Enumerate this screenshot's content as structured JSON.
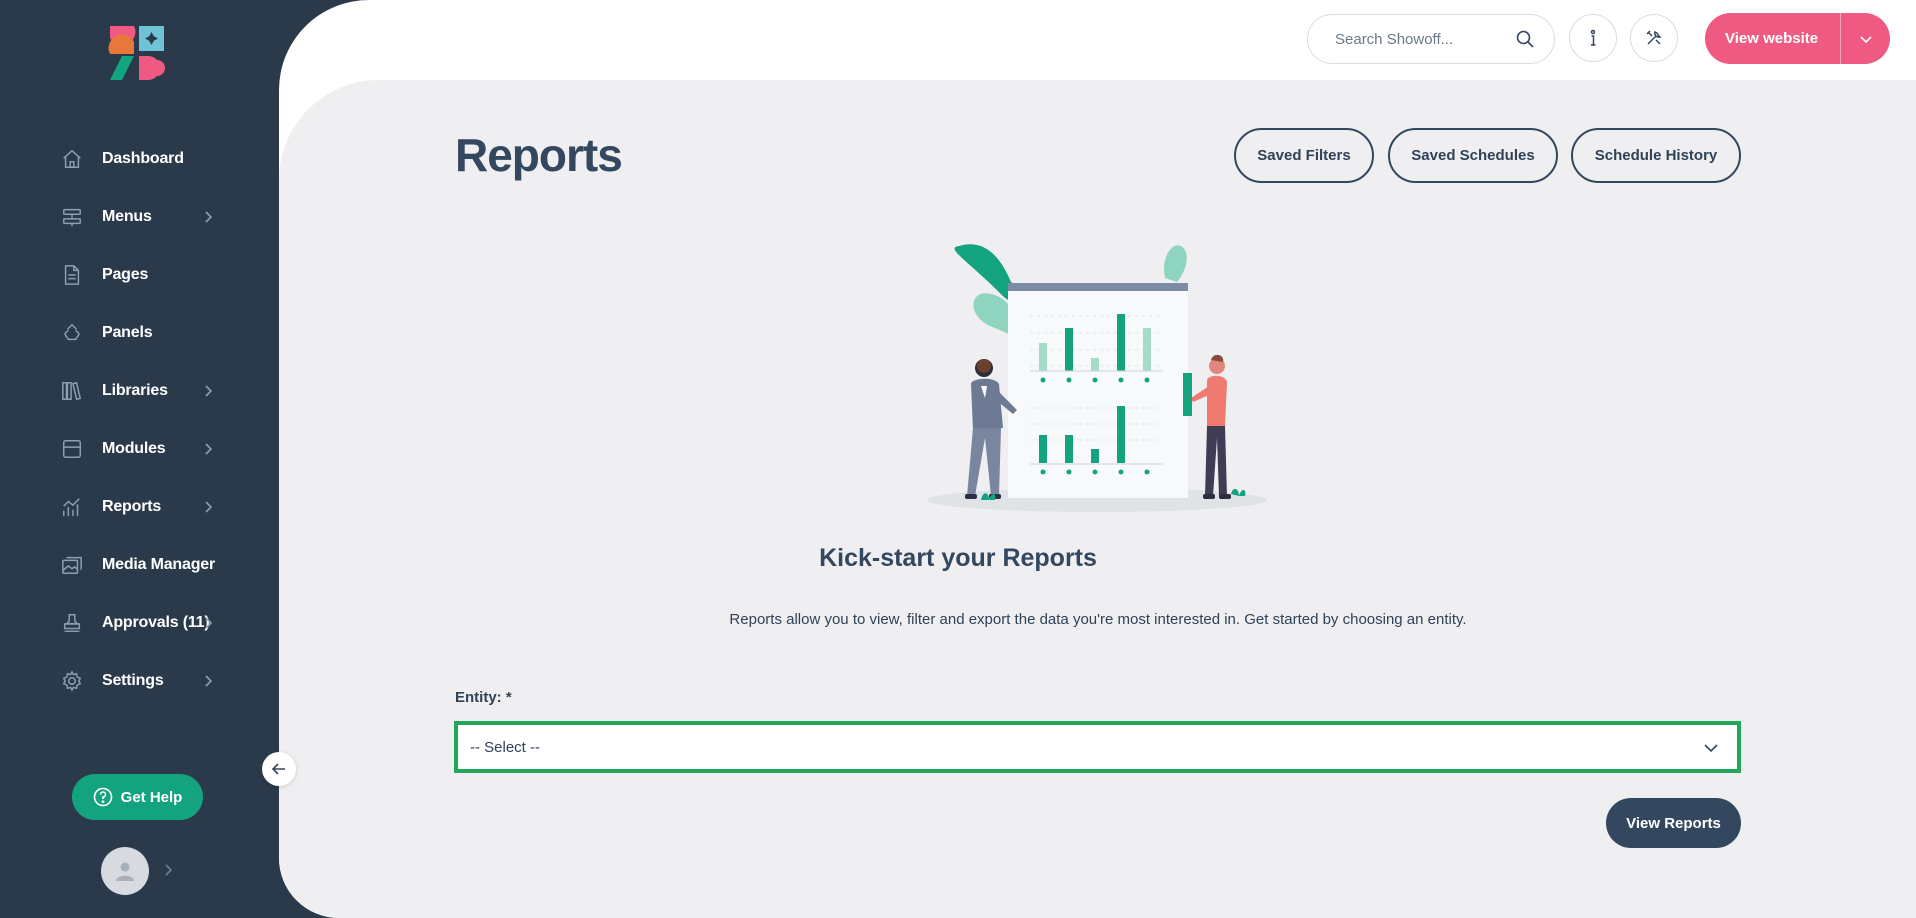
{
  "sidebar": {
    "items": [
      {
        "label": "Dashboard",
        "icon": "home-icon",
        "has_children": false
      },
      {
        "label": "Menus",
        "icon": "menu-icon",
        "has_children": true
      },
      {
        "label": "Pages",
        "icon": "page-icon",
        "has_children": false
      },
      {
        "label": "Panels",
        "icon": "panels-icon",
        "has_children": false
      },
      {
        "label": "Libraries",
        "icon": "books-icon",
        "has_children": true
      },
      {
        "label": "Modules",
        "icon": "box-icon",
        "has_children": true
      },
      {
        "label": "Reports",
        "icon": "chart-icon",
        "has_children": true
      },
      {
        "label": "Media Manager",
        "icon": "media-icon",
        "has_children": false
      },
      {
        "label": "Approvals (11)",
        "icon": "stamp-icon",
        "has_children": true
      },
      {
        "label": "Settings",
        "icon": "gear-icon",
        "has_children": true
      }
    ],
    "get_help_label": "Get Help"
  },
  "topbar": {
    "search_placeholder": "Search Showoff...",
    "view_website_label": "View website"
  },
  "page": {
    "title": "Reports",
    "buttons": {
      "saved_filters": "Saved Filters",
      "saved_schedules": "Saved Schedules",
      "schedule_history": "Schedule History"
    },
    "kick_title": "Kick-start your Reports",
    "kick_desc": "Reports allow you to view, filter and export the data you're most interested in. Get started by choosing an entity.",
    "entity_label": "Entity: *",
    "entity_selected": "-- Select --",
    "view_reports_label": "View Reports"
  },
  "colors": {
    "sidebar_bg": "#2b3a4a",
    "accent_green": "#14a37f",
    "accent_pink": "#ee5a82",
    "navy": "#33475f",
    "focus_green": "#21a65a"
  }
}
